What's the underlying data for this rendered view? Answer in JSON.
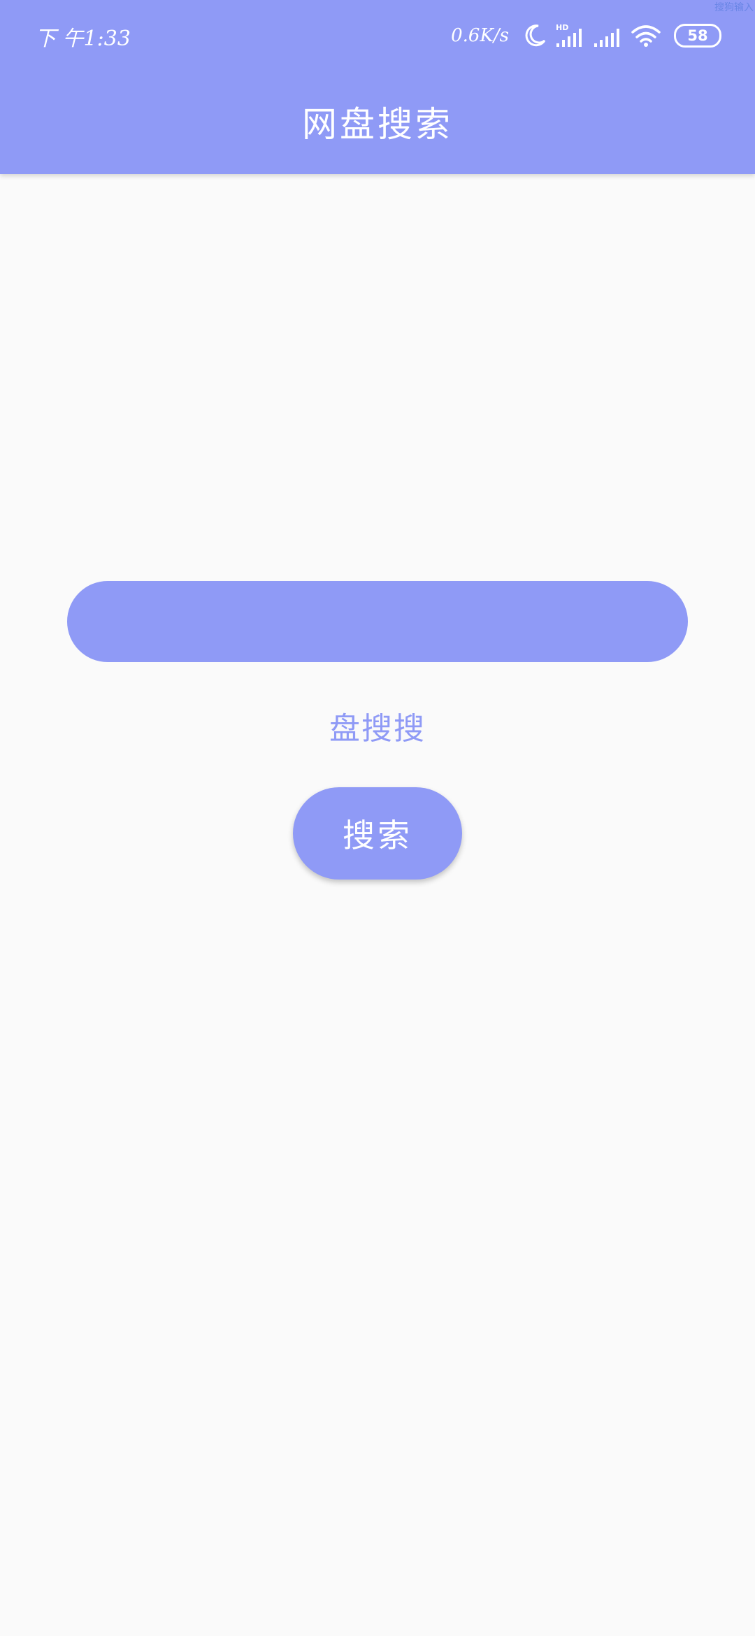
{
  "status_bar": {
    "time": "下 午1:33",
    "net_speed": "0.6K/s",
    "battery": "58",
    "hd_label": "HD",
    "corner_tag": "搜狗输入"
  },
  "icons": {
    "moon": "moon-icon",
    "signal_hd": "signal-hd-icon",
    "signal": "signal-icon",
    "wifi": "wifi-icon"
  },
  "header": {
    "title": "网盘搜索"
  },
  "search": {
    "value": "",
    "placeholder": ""
  },
  "source_label": "盘搜搜",
  "search_button": "搜索",
  "colors": {
    "primary": "#8f9af6",
    "background": "#fafafa",
    "text_on_primary": "#ffffff"
  }
}
